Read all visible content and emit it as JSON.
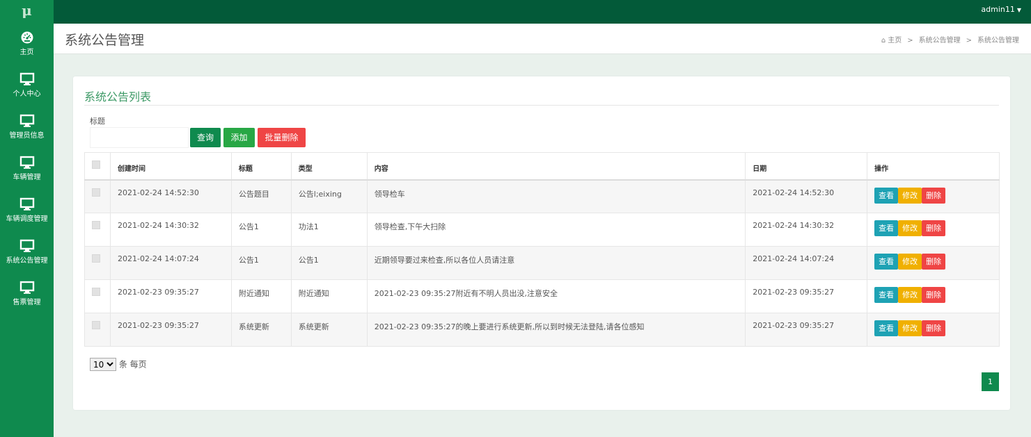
{
  "brand": {
    "logo": "μ"
  },
  "user": {
    "name": "admin11"
  },
  "sidebar": {
    "items": [
      {
        "label": "主页",
        "icon": "dashboard-icon"
      },
      {
        "label": "个人中心",
        "icon": "monitor-icon"
      },
      {
        "label": "管理员信息",
        "icon": "monitor-icon"
      },
      {
        "label": "车辆管理",
        "icon": "monitor-icon"
      },
      {
        "label": "车辆调度管理",
        "icon": "monitor-icon"
      },
      {
        "label": "系统公告管理",
        "icon": "monitor-icon"
      },
      {
        "label": "售票管理",
        "icon": "monitor-icon"
      }
    ]
  },
  "header": {
    "title": "系统公告管理",
    "breadcrumb": [
      "主页",
      "系统公告管理",
      "系统公告管理"
    ]
  },
  "card": {
    "title": "系统公告列表",
    "search": {
      "label": "标题",
      "value": "",
      "placeholder": ""
    },
    "buttons": {
      "query": "查询",
      "add": "添加",
      "batch_delete": "批量删除"
    }
  },
  "table": {
    "columns": [
      "创建时间",
      "标题",
      "类型",
      "内容",
      "日期",
      "操作"
    ],
    "rows": [
      {
        "created": "2021-02-24 14:52:30",
        "title": "公告题目",
        "type": "公告l;eixing",
        "content": "领导检车",
        "date": "2021-02-24 14:52:30"
      },
      {
        "created": "2021-02-24 14:30:32",
        "title": "公告1",
        "type": "功法1",
        "content": "领导检查,下午大扫除",
        "date": "2021-02-24 14:30:32"
      },
      {
        "created": "2021-02-24 14:07:24",
        "title": "公告1",
        "type": "公告1",
        "content": "近期领导要过来检查,所以各位人员请注意",
        "date": "2021-02-24 14:07:24"
      },
      {
        "created": "2021-02-23 09:35:27",
        "title": "附近通知",
        "type": "附近通知",
        "content": "2021-02-23 09:35:27附近有不明人员出没,注意安全",
        "date": "2021-02-23 09:35:27"
      },
      {
        "created": "2021-02-23 09:35:27",
        "title": "系统更新",
        "type": "系统更新",
        "content": "2021-02-23 09:35:27的晚上要进行系统更新,所以到时候无法登陆,请各位感知",
        "date": "2021-02-23 09:35:27"
      }
    ],
    "actions": {
      "view": "查看",
      "edit": "修改",
      "delete": "删除"
    }
  },
  "pagination": {
    "page_size": "10",
    "page_size_suffix": "条 每页",
    "current_page": "1"
  },
  "colors": {
    "topbar": "#035a39",
    "sidebar": "#0f8a4e",
    "accent_title": "#3d9a66",
    "view": "#1ea2b4",
    "edit": "#f0b000",
    "delete": "#ef4545"
  }
}
